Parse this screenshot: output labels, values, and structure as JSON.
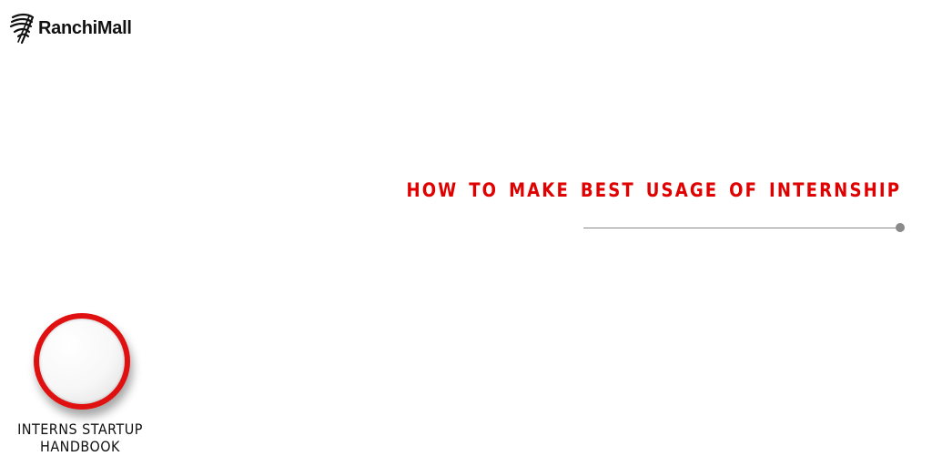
{
  "brand": {
    "logo_icon": "ranchimall-wing-logo",
    "name": "RanchiMall"
  },
  "headline": {
    "text": "HOW TO MAKE BEST USAGE OF INTERNSHIP",
    "color": "#e00000"
  },
  "badge": {
    "line1": "INTERNS STARTUP",
    "line2": "HANDBOOK",
    "ring_color": "#e01010"
  }
}
